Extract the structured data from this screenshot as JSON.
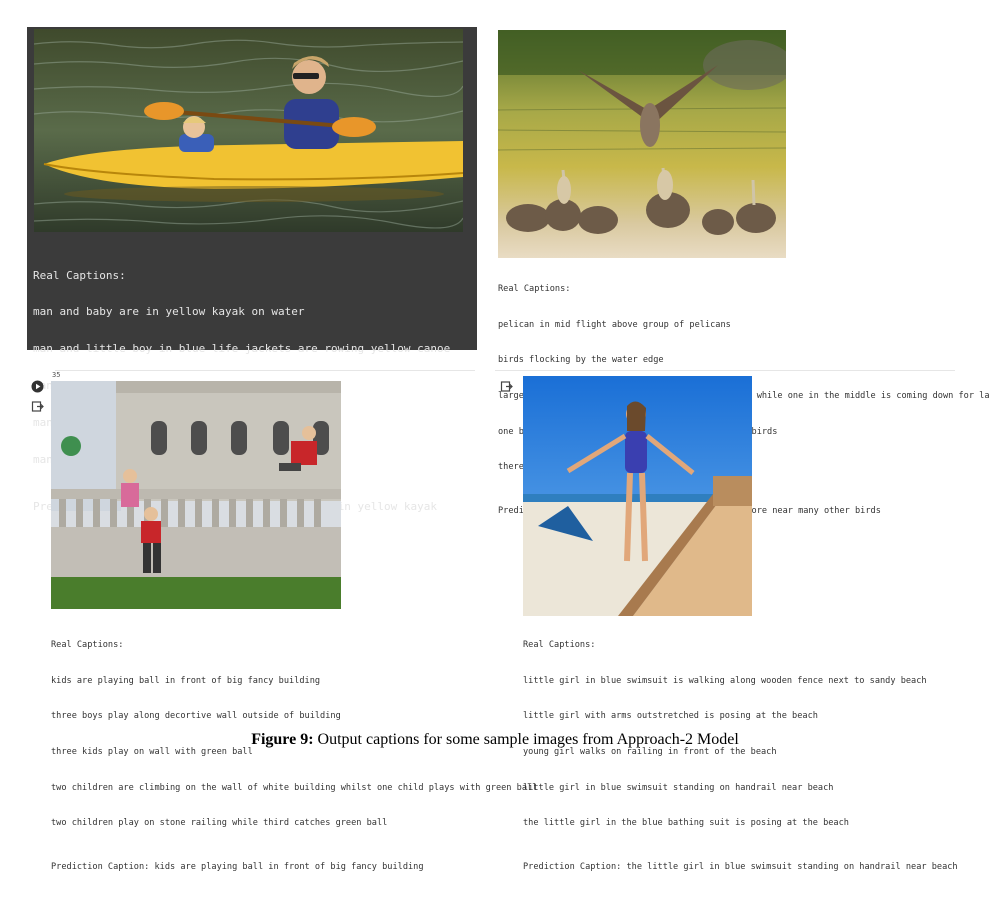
{
  "panels": [
    {
      "real_label": "Real Captions:",
      "captions": [
        "man and baby are in yellow kayak on water",
        "man and little boy in blue life jackets are rowing yellow canoe",
        "man and child kayak through gentle waters",
        "man and young boy ride in yellow kayak",
        "man and child in yellow kayak"
      ],
      "prediction": "Prediction Caption: man and child are sitting in yellow kayak"
    },
    {
      "real_label": "Real Captions:",
      "captions": [
        "pelican in mid flight above group of pelicans",
        "birds flocking by the water edge",
        "large birds standing on the edge of body of water while one in the middle is coming down for landing",
        "one bird is landing on the shore near many other birds",
        "there are several pelicans and one is flying"
      ],
      "prediction": "Prediction Caption: one bird is landing on the shore near many other birds"
    },
    {
      "cell_number": "35",
      "real_label": "Real Captions:",
      "captions": [
        "kids are playing ball in front of big fancy building",
        "three boys play along decortive wall outside of building",
        "three kids play on wall with green ball",
        "two children are climbing on the wall of white building whilst one child plays with green ball",
        "two children play on stone railing while third catches green ball"
      ],
      "prediction": "Prediction Caption: kids are playing ball in front of big fancy building"
    },
    {
      "real_label": "Real Captions:",
      "captions": [
        "little girl in blue swimsuit is walking along wooden fence next to sandy beach",
        "little girl with arms outstretched is posing at the beach",
        "young girl walks on railing in front of the beach",
        "little girl in blue swimsuit standing on handrail near beach",
        "the little girl in the blue bathing suit is posing at the beach"
      ],
      "prediction": "Prediction Caption: the little girl in blue swimsuit standing on handrail near beach"
    }
  ],
  "figure": {
    "label": "Figure 9:",
    "text": "Output captions for some sample images from Approach-2 Model"
  },
  "icons": [
    "run-cell-icon",
    "output-icon"
  ]
}
